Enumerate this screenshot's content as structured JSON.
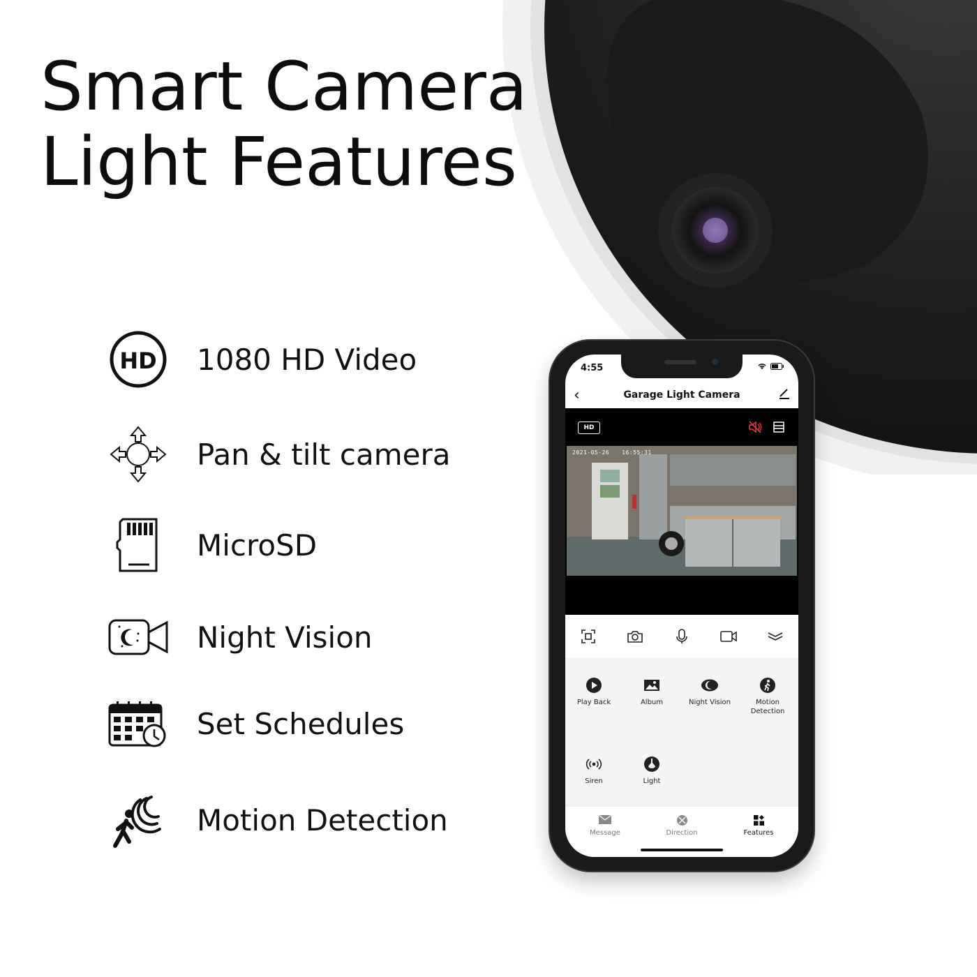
{
  "headline": {
    "line1": "Smart Camera",
    "line2": "Light Features"
  },
  "features": [
    {
      "icon": "hd-icon",
      "label": "1080 HD Video"
    },
    {
      "icon": "pan-tilt-icon",
      "label": "Pan & tilt camera"
    },
    {
      "icon": "microsd-icon",
      "label": "MicroSD"
    },
    {
      "icon": "night-vision-icon",
      "label": "Night Vision"
    },
    {
      "icon": "calendar-clock-icon",
      "label": "Set Schedules"
    },
    {
      "icon": "motion-icon",
      "label": "Motion Detection"
    }
  ],
  "phone": {
    "status": {
      "time": "4:55"
    },
    "nav": {
      "title": "Garage Light Camera",
      "back_icon": "chevron-left-icon",
      "edit_icon": "pencil-icon"
    },
    "video": {
      "quality_badge": "HD",
      "mute_color": "#e53935",
      "osd_date": "2021-05-26",
      "osd_time": "16:55:31"
    },
    "controls": [
      {
        "icon": "fullscreen-icon"
      },
      {
        "icon": "camera-icon"
      },
      {
        "icon": "microphone-icon"
      },
      {
        "icon": "record-icon"
      },
      {
        "icon": "collapse-icon"
      }
    ],
    "grid": [
      {
        "icon": "play-icon",
        "label": "Play Back"
      },
      {
        "icon": "album-icon",
        "label": "Album"
      },
      {
        "icon": "night-vision-icon",
        "label": "Night Vision"
      },
      {
        "icon": "motion-icon",
        "label": "Motion Detection"
      },
      {
        "icon": "siren-icon",
        "label": "Siren"
      },
      {
        "icon": "light-icon",
        "label": "Light"
      }
    ],
    "tabs": [
      {
        "icon": "message-icon",
        "label": "Message",
        "active": false
      },
      {
        "icon": "direction-icon",
        "label": "Direction",
        "active": false
      },
      {
        "icon": "features-icon",
        "label": "Features",
        "active": true
      }
    ]
  }
}
